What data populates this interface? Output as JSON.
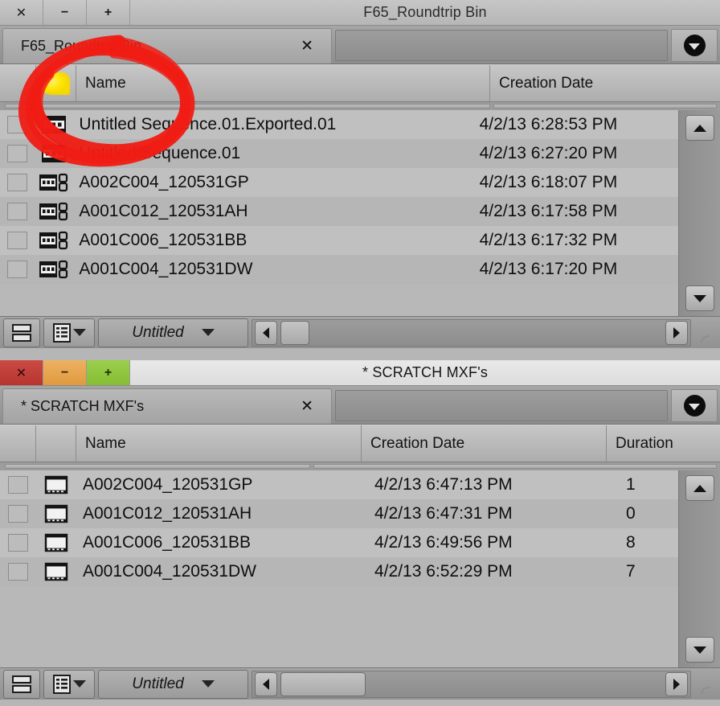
{
  "top_window": {
    "title": "F65_Roundtrip Bin",
    "controls": {
      "close": "✕",
      "minimize": "−",
      "maximize": "+"
    },
    "tab": {
      "label": "F65_Roundtrip Bin",
      "close": "✕"
    },
    "tab_menu_icon": "circle-chevron-down-icon",
    "columns": [
      {
        "key": "check",
        "label": ""
      },
      {
        "key": "marker",
        "label": ""
      },
      {
        "key": "name",
        "label": "Name"
      },
      {
        "key": "date",
        "label": "Creation Date"
      }
    ],
    "rows": [
      {
        "name": "Untitled Sequence.01.Exported.01",
        "date": "4/2/13 6:28:53 PM",
        "icon": "sequence-icon"
      },
      {
        "name": "Untitled Sequence.01",
        "date": "4/2/13 6:27:20 PM",
        "icon": "sequence-icon"
      },
      {
        "name": "A002C004_120531GP",
        "date": "4/2/13 6:18:07 PM",
        "icon": "linked-clip-icon"
      },
      {
        "name": "A001C012_120531AH",
        "date": "4/2/13 6:17:58 PM",
        "icon": "linked-clip-icon"
      },
      {
        "name": "A001C006_120531BB",
        "date": "4/2/13 6:17:32 PM",
        "icon": "linked-clip-icon"
      },
      {
        "name": "A001C004_120531DW",
        "date": "4/2/13 6:17:20 PM",
        "icon": "linked-clip-icon"
      }
    ],
    "toolbar": {
      "view_label": "Untitled"
    }
  },
  "bottom_window": {
    "title": "* SCRATCH MXF's",
    "controls": {
      "close": "✕",
      "minimize": "−",
      "maximize": "+"
    },
    "tab": {
      "label": "* SCRATCH MXF's",
      "close": "✕"
    },
    "tab_menu_icon": "circle-chevron-down-icon",
    "columns": [
      {
        "key": "check",
        "label": ""
      },
      {
        "key": "icon",
        "label": ""
      },
      {
        "key": "name",
        "label": "Name"
      },
      {
        "key": "date",
        "label": "Creation Date"
      },
      {
        "key": "duration",
        "label": "Duration"
      }
    ],
    "rows": [
      {
        "name": "A002C004_120531GP",
        "date": "4/2/13 6:47:13 PM",
        "duration": "1",
        "icon": "master-clip-icon"
      },
      {
        "name": "A001C012_120531AH",
        "date": "4/2/13 6:47:31 PM",
        "duration": "0",
        "icon": "master-clip-icon"
      },
      {
        "name": "A001C006_120531BB",
        "date": "4/2/13 6:49:56 PM",
        "duration": "8",
        "icon": "master-clip-icon"
      },
      {
        "name": "A001C004_120531DW",
        "date": "4/2/13 6:52:29 PM",
        "duration": "7",
        "icon": "master-clip-icon"
      }
    ],
    "toolbar": {
      "view_label": "Untitled"
    }
  },
  "annotation": {
    "type": "hand-drawn-ellipse",
    "color": "#f01c14",
    "target": "checkbox-and-marker-columns"
  },
  "colors": {
    "close_red": "#c0392b",
    "minimize_orange": "#e8a34a",
    "maximize_green": "#8cc63f",
    "marker_yellow": "#ffe400",
    "annotation_red": "#f01c14",
    "window_chrome": "#b6b6b6"
  }
}
